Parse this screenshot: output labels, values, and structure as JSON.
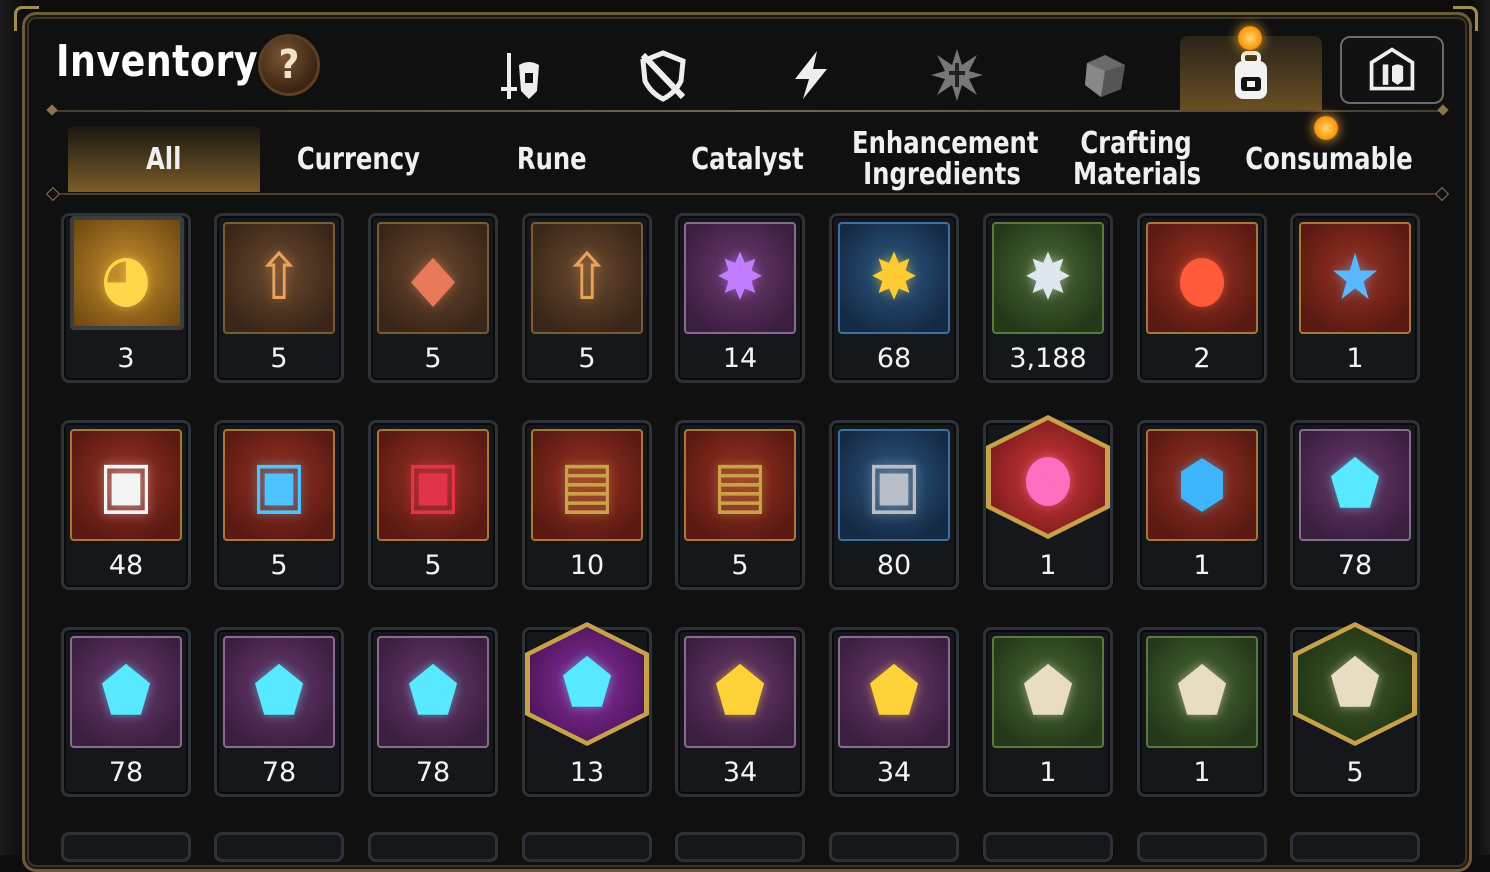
{
  "window": {
    "title": "Inventory",
    "help_label": "?"
  },
  "categories": [
    {
      "name": "equipment",
      "icon": "helmet-sword-icon",
      "active": false
    },
    {
      "name": "unequipped",
      "icon": "shield-slash-icon",
      "active": false
    },
    {
      "name": "energy",
      "icon": "lightning-icon",
      "active": false
    },
    {
      "name": "artifact",
      "icon": "burst-icon",
      "active": false
    },
    {
      "name": "material",
      "icon": "cube-icon",
      "active": false
    },
    {
      "name": "bag",
      "icon": "backpack-icon",
      "active": true
    },
    {
      "name": "shop",
      "icon": "shop-helmet-icon",
      "active": false
    }
  ],
  "tabs": [
    {
      "label": "All",
      "active": true
    },
    {
      "label": "Currency",
      "active": false
    },
    {
      "label": "Rune",
      "active": false
    },
    {
      "label": "Catalyst",
      "active": false
    },
    {
      "label": "Enhancement Ingredients",
      "active": false
    },
    {
      "label": "Crafting Materials",
      "active": false
    },
    {
      "label": "Consumable",
      "active": false
    }
  ],
  "items": [
    {
      "count": "3",
      "icon": "phoenix-portrait-icon",
      "frame": "circle"
    },
    {
      "count": "5",
      "icon": "scroll-upgrade-icon",
      "frame": "brown"
    },
    {
      "count": "5",
      "icon": "scroll-rainbow-cube-icon",
      "frame": "brown"
    },
    {
      "count": "5",
      "icon": "scroll-upgrade-icon",
      "frame": "brown"
    },
    {
      "count": "14",
      "icon": "purple-crystal-icon",
      "frame": "purple"
    },
    {
      "count": "68",
      "icon": "gold-crystal-icon",
      "frame": "blue"
    },
    {
      "count": "3,188",
      "icon": "silver-crystal-icon",
      "frame": "green"
    },
    {
      "count": "2",
      "icon": "red-potion-icon",
      "frame": "red"
    },
    {
      "count": "1",
      "icon": "blue-star-potion-icon",
      "frame": "red"
    },
    {
      "count": "48",
      "icon": "white-chest-icon",
      "frame": "red"
    },
    {
      "count": "5",
      "icon": "blue-orb-chest-icon",
      "frame": "red"
    },
    {
      "count": "5",
      "icon": "red-chest-icon",
      "frame": "red"
    },
    {
      "count": "10",
      "icon": "gold-treasure-chest-icon",
      "frame": "red"
    },
    {
      "count": "5",
      "icon": "gold-treasure-chest-icon",
      "frame": "red"
    },
    {
      "count": "80",
      "icon": "silver-chest-icon",
      "frame": "blue"
    },
    {
      "count": "1",
      "icon": "pink-potion-icon",
      "frame": "hex-red"
    },
    {
      "count": "1",
      "icon": "blue-rune-stone-icon",
      "frame": "red"
    },
    {
      "count": "78",
      "icon": "sword-rune-icon",
      "frame": "purple"
    },
    {
      "count": "78",
      "icon": "helmet-rune-icon",
      "frame": "purple"
    },
    {
      "count": "78",
      "icon": "armor-rune-icon",
      "frame": "purple"
    },
    {
      "count": "78",
      "icon": "boots-rune-icon",
      "frame": "purple"
    },
    {
      "count": "13",
      "icon": "star-rune-icon",
      "frame": "hex-purple"
    },
    {
      "count": "34",
      "icon": "hammer-rune-icon",
      "frame": "purple"
    },
    {
      "count": "34",
      "icon": "exclaim-rune-icon",
      "frame": "purple"
    },
    {
      "count": "1",
      "icon": "sword-stone-rune-icon",
      "frame": "green"
    },
    {
      "count": "1",
      "icon": "armor-stone-rune-icon",
      "frame": "green"
    },
    {
      "count": "5",
      "icon": "star-stone-rune-icon",
      "frame": "hex-green"
    }
  ],
  "colors": {
    "panel_border": "#6d5a3c",
    "active_tab": "#7b5d2a",
    "notification_dot": "#ff9a14"
  }
}
